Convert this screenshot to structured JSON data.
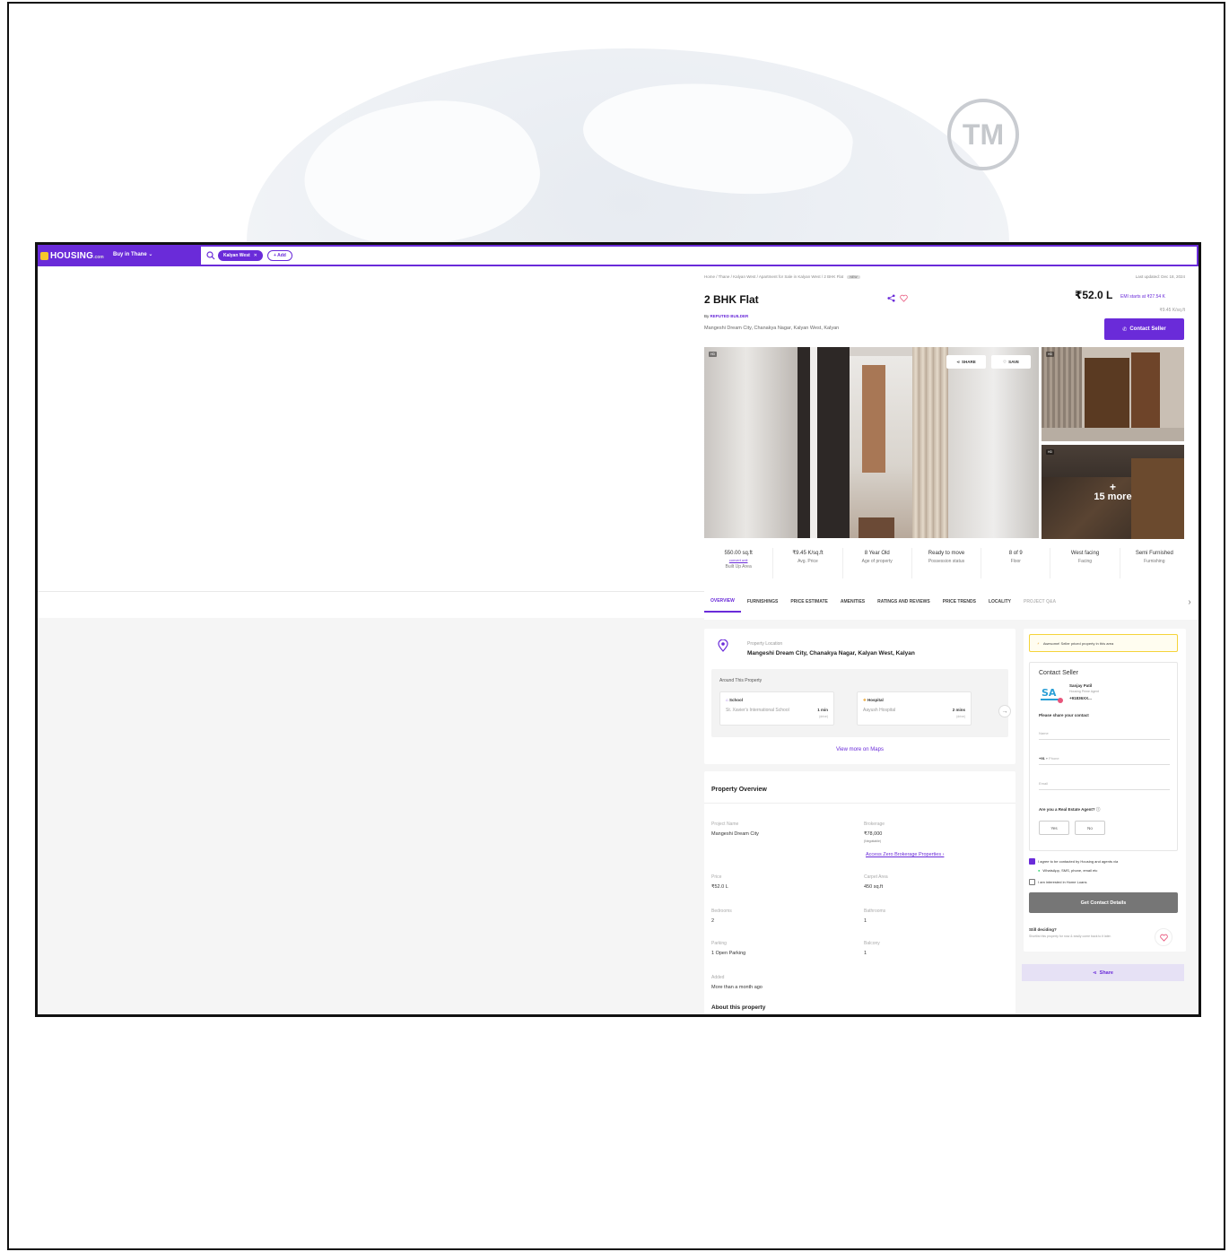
{
  "watermark": {
    "tm_text": "TM"
  },
  "header": {
    "brand": "HOUSING",
    "brand_tld": ".com",
    "city_select": "Buy in Thane",
    "search_chip": "Kalyan West",
    "add_chip": "+ Add"
  },
  "breadcrumb": {
    "path": "Home / Thane / Kalyan West / Apartment for Sale in Kalyan West / 2 BHK Flat",
    "badge": "NEW"
  },
  "listing": {
    "last_updated": "Last updated: Dec 18, 2024",
    "title": "2 BHK Flat",
    "price": "₹52.0 L",
    "emi": "EMI starts at ₹27.54 K",
    "per_sqft": "₹9.45 K/sq.ft",
    "builder_prefix": "By",
    "builder": "REPUTED BUILDER",
    "address": "Mangeshi Dream City, Chanakya Nagar, Kalyan West, Kalyan",
    "contact_button": "Contact Seller"
  },
  "gallery": {
    "hd_badge": "HD",
    "share": "SHARE",
    "save": "SAVE",
    "more_plus": "+",
    "more_label": "15 more"
  },
  "stats": [
    {
      "value": "550.00 sq.ft",
      "link": "convert unit",
      "label": "Built Up Area"
    },
    {
      "value": "₹9.45 K/sq.ft",
      "label": "Avg. Price"
    },
    {
      "value": "8 Year Old",
      "label": "Age of property"
    },
    {
      "value": "Ready to move",
      "label": "Possession status"
    },
    {
      "value": "8 of 9",
      "label": "Floor"
    },
    {
      "value": "West facing",
      "label": "Facing"
    },
    {
      "value": "Semi Furnished",
      "label": "Furnishing"
    }
  ],
  "tabs": [
    "OVERVIEW",
    "FURNISHINGS",
    "PRICE ESTIMATE",
    "AMENITIES",
    "RATINGS AND REVIEWS",
    "PRICE TRENDS",
    "LOCALITY",
    "PROJECT Q&A"
  ],
  "location": {
    "label": "Property Location",
    "value": "Mangeshi Dream City, Chanakya Nagar, Kalyan West, Kalyan",
    "around_title": "Around This Property",
    "items": [
      {
        "type": "School",
        "name": "St. Xavier's International School",
        "time": "1 min",
        "mode": "(drive)"
      },
      {
        "type": "Hospital",
        "name": "Aayush Hospital",
        "time": "2 mins",
        "mode": "(drive)"
      }
    ],
    "view_maps": "View more on Maps"
  },
  "overview": {
    "title": "Property Overview",
    "project_name_label": "Project Name",
    "project_name": "Mangeshi Dream City",
    "brokerage_label": "Brokerage",
    "brokerage": "₹78,000",
    "brokerage_note": "(Negotiable)",
    "brokerage_link": "Access Zero Brokerage Properties ›",
    "price_label": "Price",
    "price": "₹52.0 L",
    "carpet_label": "Carpet Area",
    "carpet": "450 sq.ft",
    "bedrooms_label": "Bedrooms",
    "bedrooms": "2",
    "bathrooms_label": "Bathrooms",
    "bathrooms": "1",
    "parking_label": "Parking",
    "parking": "1 Open Parking",
    "balcony_label": "Balcony",
    "balcony": "1",
    "added_label": "Added",
    "added": "More than a month ago",
    "about_title": "About this property"
  },
  "seller": {
    "banner": "Awesome! Seller priced property in this area",
    "contact_title": "Contact Seller",
    "agent_logo_text": "SA",
    "agent_name": "Sanjay Patil",
    "agent_role": "Housing Prime Agent",
    "agent_phone": "+91836XX...",
    "share_prompt": "Please share your contact",
    "name_placeholder": "Name",
    "country_code": "+91",
    "phone_placeholder": "Phone",
    "email_placeholder": "Email",
    "agent_question": "Are you a Real Estate Agent?",
    "yes": "Yes",
    "no": "No",
    "consent_1": "I agree to be contacted by Housing and agents via",
    "consent_1b": "WhatsApp, SMS, phone, email etc",
    "consent_2": "I am interested in Home Loans",
    "get_contact": "Get Contact Details",
    "still_q": "Still deciding?",
    "still_text": "Shortlist this property for now & easily come back to it later.",
    "share": "Share"
  },
  "colors": {
    "brand": "#6a2bd9",
    "banner_border": "#f5d43a",
    "cta_disabled": "#767676"
  }
}
